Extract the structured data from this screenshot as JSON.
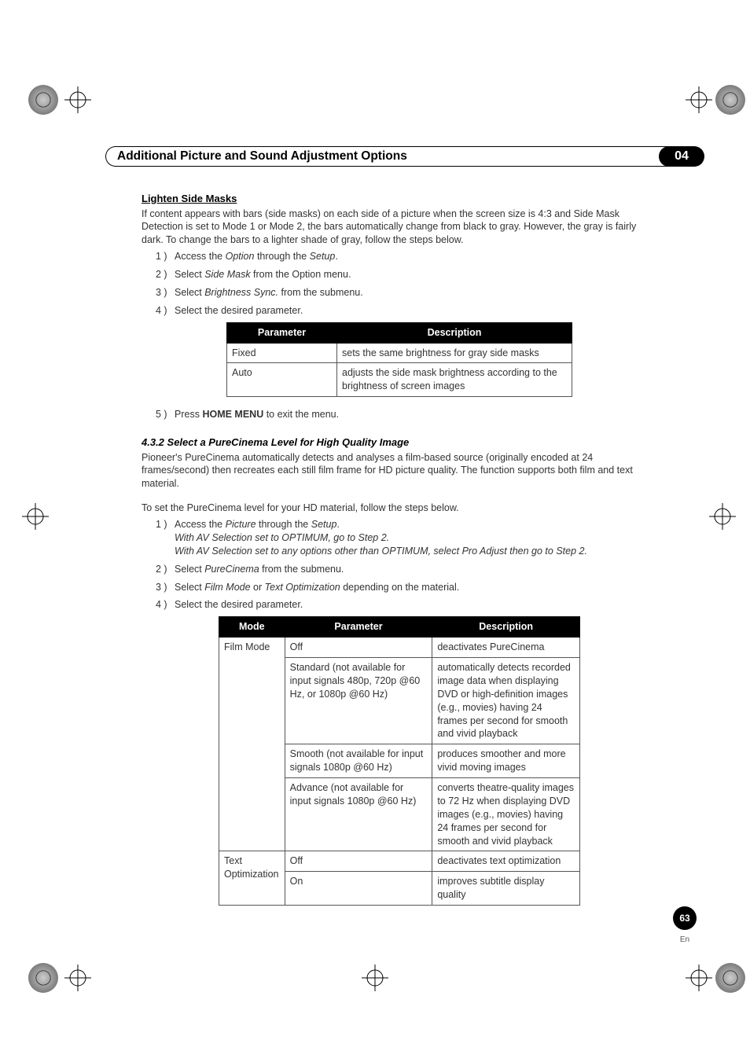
{
  "header": {
    "title": "Additional Picture and Sound Adjustment Options",
    "chapter": "04"
  },
  "section1": {
    "heading": "Lighten Side Masks",
    "intro": "If content appears with bars (side masks) on each side of a picture when the screen size is 4:3 and Side Mask Detection is set to Mode 1 or Mode 2, the bars automatically change from black to gray. However, the gray is fairly dark. To change the bars to a lighter shade of gray, follow the steps below.",
    "steps": [
      {
        "num": "1 )",
        "pre": "Access the ",
        "i1": "Option",
        "mid": " through the ",
        "i2": "Setup",
        "post": "."
      },
      {
        "num": "2 )",
        "pre": "Select ",
        "i1": "Side Mask",
        "mid": "",
        "i2": "",
        "post": " from the Option menu."
      },
      {
        "num": "3 )",
        "pre": "Select ",
        "i1": "Brightness Sync.",
        "mid": "",
        "i2": "",
        "post": " from the submenu."
      },
      {
        "num": "4 )",
        "pre": "Select the desired parameter.",
        "i1": "",
        "mid": "",
        "i2": "",
        "post": ""
      }
    ],
    "table": {
      "headers": [
        "Parameter",
        "Description"
      ],
      "rows": [
        [
          "Fixed",
          "sets the same brightness for gray side masks"
        ],
        [
          "Auto",
          "adjusts the side mask brightness according to the brightness of screen images"
        ]
      ]
    },
    "step5": {
      "num": "5 )",
      "pre": "Press ",
      "b1": "HOME MENU",
      "post": " to exit the menu."
    }
  },
  "section2": {
    "numtitle": "4.3.2  Select a PureCinema Level for High Quality Image",
    "intro": "Pioneer's PureCinema automatically detects and analyses a film-based source (originally encoded at 24 frames/second) then recreates each still film frame for HD picture quality. The function supports both film and text material.",
    "lead": "To set the PureCinema level for your HD material, follow the steps below.",
    "steps": [
      {
        "num": "1 )",
        "pre": "Access the ",
        "i1": "Picture",
        "mid": " through the ",
        "i2": "Setup",
        "post": ".",
        "subs": [
          "With AV Selection set to OPTIMUM, go to Step 2.",
          "With AV Selection set to any options other than OPTIMUM, select Pro Adjust then go to Step 2."
        ]
      },
      {
        "num": "2 )",
        "pre": "Select ",
        "i1": "PureCinema",
        "mid": "",
        "i2": "",
        "post": " from the submenu."
      },
      {
        "num": "3 )",
        "pre": "Select ",
        "i1": "Film Mode",
        "mid": " or ",
        "i2": "Text Optimization",
        "post": " depending on the material."
      },
      {
        "num": "4 )",
        "pre": "Select the desired parameter.",
        "i1": "",
        "mid": "",
        "i2": "",
        "post": ""
      }
    ],
    "table": {
      "headers": [
        "Mode",
        "Parameter",
        "Description"
      ],
      "rows": [
        {
          "mode": "Film Mode",
          "rowspan": 4,
          "param": "Off",
          "desc": "deactivates PureCinema"
        },
        {
          "param": "Standard (not available for input signals 480p, 720p @60 Hz, or 1080p @60 Hz)",
          "desc": "automatically detects recorded image data when displaying DVD or high-definition images (e.g., movies) having 24 frames per second for smooth and vivid playback"
        },
        {
          "param": "Smooth (not available for input signals 1080p @60 Hz)",
          "desc": "produces smoother and more vivid moving images"
        },
        {
          "param": "Advance (not available for input signals 1080p @60 Hz)",
          "desc": "converts theatre-quality images to 72 Hz when displaying DVD images (e.g., movies) having 24 frames per second for smooth and vivid playback"
        },
        {
          "mode": "Text Optimization",
          "rowspan": 2,
          "param": "Off",
          "desc": "deactivates text optimization"
        },
        {
          "param": "On",
          "desc": "improves subtitle display quality"
        }
      ]
    }
  },
  "footer": {
    "page": "63",
    "lang": "En"
  },
  "chart_data": null
}
